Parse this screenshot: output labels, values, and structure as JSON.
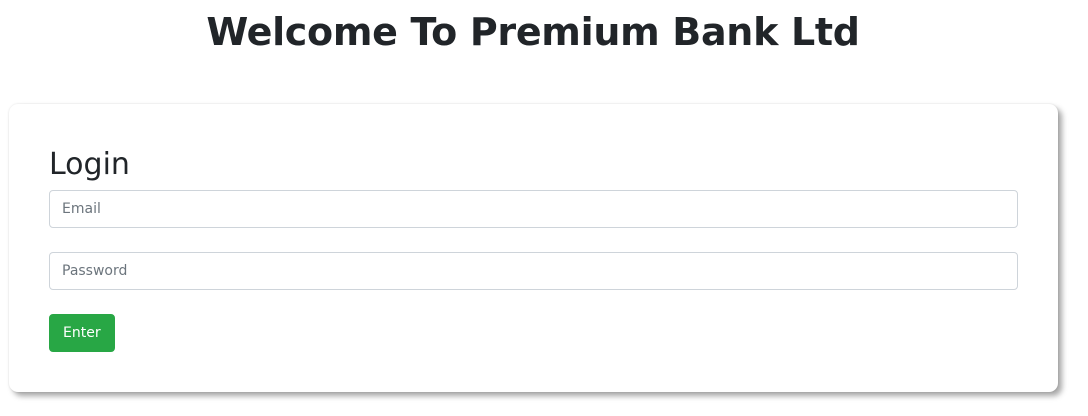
{
  "page": {
    "title": "Welcome To Premium Bank Ltd"
  },
  "login": {
    "heading": "Login",
    "email_placeholder": "Email",
    "email_value": "",
    "password_placeholder": "Password",
    "password_value": "",
    "submit_label": "Enter"
  },
  "colors": {
    "primary_button": "#28a745",
    "text": "#212529",
    "input_border": "#ced4da"
  }
}
